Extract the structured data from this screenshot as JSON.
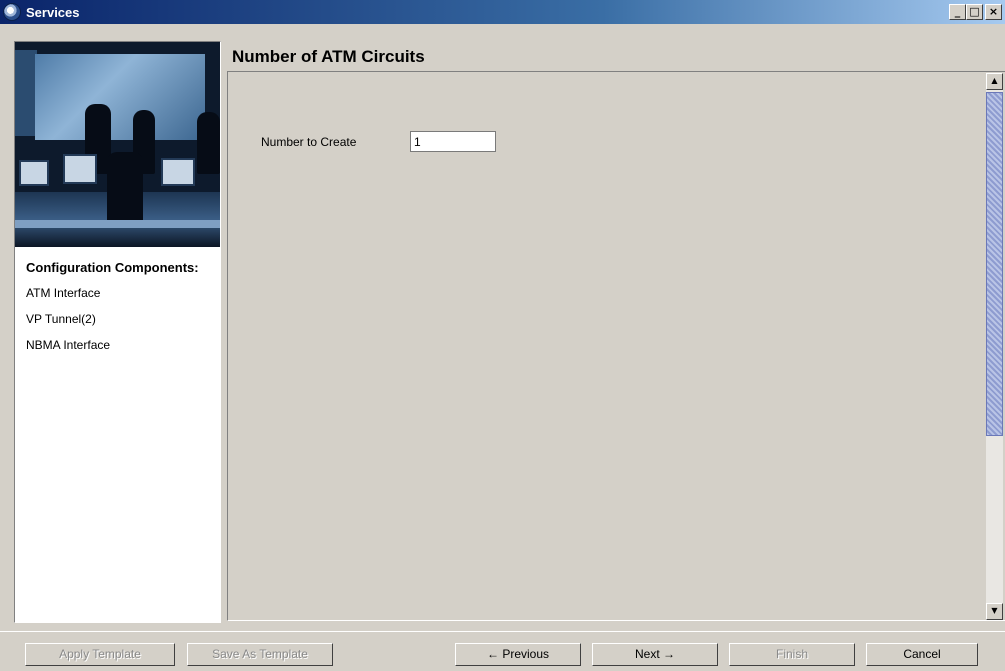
{
  "window": {
    "title": "Services",
    "minimize_label": "_",
    "maximize_label": "□",
    "close_label": "×"
  },
  "left_panel": {
    "heading": "Configuration Components:",
    "items": [
      {
        "label": "ATM Interface"
      },
      {
        "label": "VP Tunnel(2)"
      },
      {
        "label": "NBMA Interface"
      }
    ]
  },
  "main": {
    "title": "Number of ATM Circuits",
    "fields": {
      "number_to_create": {
        "label": "Number to Create",
        "value": "1"
      }
    },
    "scrollbar": {
      "up_arrow": "▲",
      "down_arrow": "▼"
    }
  },
  "buttons": {
    "apply_template": "Apply Template",
    "save_as_template": "Save As Template",
    "previous": "← Previous",
    "next": "Next →",
    "finish": "Finish",
    "cancel": "Cancel"
  },
  "colors": {
    "titlebar_start": "#0a246a",
    "titlebar_end": "#a6caf0",
    "background": "#d4d0c8",
    "scroll_thumb": "#8e9cd0"
  }
}
